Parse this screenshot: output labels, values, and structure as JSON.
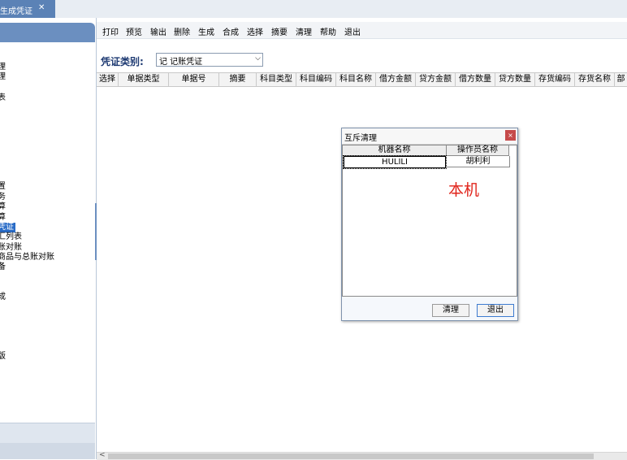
{
  "tab": {
    "title": "生成凭证",
    "close": "✕"
  },
  "sidebar": {
    "items": [
      "理",
      "理",
      "表",
      "置",
      "务",
      "算",
      "算",
      "凭证",
      "汇列表",
      "账对账",
      "商品与总账对账",
      "备",
      "成",
      "版"
    ],
    "selected_index": 7
  },
  "toolbar": [
    "打印",
    "预览",
    "输出",
    "删除",
    "生成",
    "合成",
    "选择",
    "摘要",
    "清理",
    "帮助",
    "退出"
  ],
  "voucher": {
    "label": "凭证类别:",
    "value": "记 记账凭证",
    "arrow": "⌵"
  },
  "table": {
    "columns": [
      "选择",
      "单据类型",
      "单据号",
      "摘要",
      "科目类型",
      "科目编码",
      "科目名称",
      "借方金额",
      "贷方金额",
      "借方数量",
      "贷方数量",
      "存货编码",
      "存货名称",
      "部"
    ]
  },
  "scrollbar": {
    "left_arrow": "<"
  },
  "dialog": {
    "title": "互斥清理",
    "close": "×",
    "columns": [
      "机器名称",
      "操作员名称"
    ],
    "rows": [
      [
        "HULILI",
        "胡利利"
      ]
    ],
    "annotation": "本机",
    "buttons": {
      "clear": "清理",
      "exit": "退出"
    }
  },
  "colors": {
    "accent": "#5b82b6",
    "selection": "#2a6cc7",
    "annotation": "#e0241b"
  }
}
